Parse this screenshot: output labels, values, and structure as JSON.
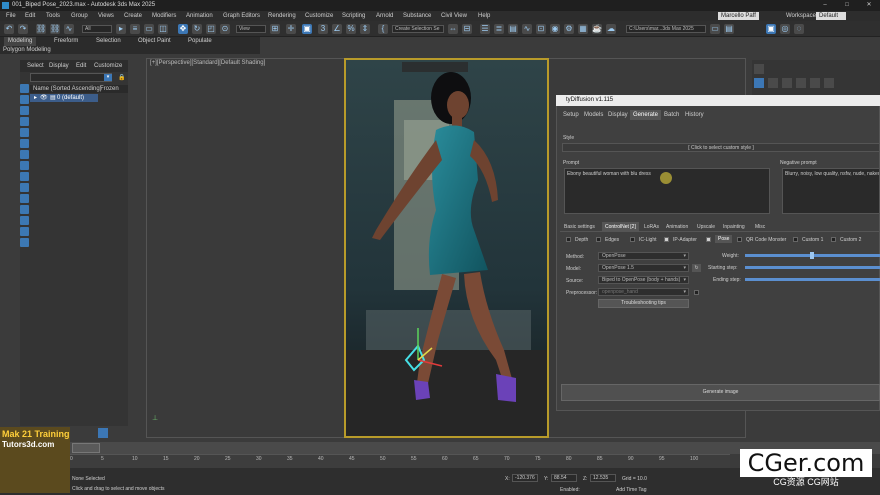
{
  "app": {
    "title": "001_Biped Pose_2023.max - Autodesk 3ds Max 2025"
  },
  "menu": [
    "File",
    "Edit",
    "Tools",
    "Group",
    "Views",
    "Create",
    "Modifiers",
    "Animation",
    "Graph Editors",
    "Rendering",
    "Customize",
    "Scripting",
    "Arnold",
    "Substance",
    "Civil View",
    "Help"
  ],
  "user": {
    "name": "Marcello Paff",
    "workspaces_label": "Workspaces:",
    "workspace": "Default"
  },
  "toolbar": {
    "filter": "All",
    "view": "View",
    "selection_set": "Create Selection Se",
    "path": "C:\\Users\\mar...3ds Max 2025"
  },
  "ribbon": {
    "tabs": [
      "Modeling",
      "Freeform",
      "Selection",
      "Object Paint",
      "Populate"
    ],
    "sub": "Polygon Modeling"
  },
  "scene_explorer": {
    "menu": [
      "Select",
      "Display",
      "Edit",
      "Customize"
    ],
    "col_name": "Name (Sorted Ascending)",
    "col_frozen": "Frozen",
    "row": "0 (default)"
  },
  "viewport": {
    "label": "[+][Perspective][Standard][Default Shading]"
  },
  "sd": {
    "title": "tyDiffusion v1.115",
    "tabs": [
      "Setup",
      "Models",
      "Display",
      "Generate",
      "Batch",
      "History"
    ],
    "style_label": "Style",
    "style_hint": "[ Click to select custom style ]",
    "prompt_label": "Prompt",
    "prompt": "Ebony beautiful woman with blu dress",
    "neg_label": "Negative prompt",
    "neg": "Blurry, noisy, low quality, nsfw, nude, naked",
    "tabs2": [
      "Basic settings",
      "ControlNet [2]",
      "LoRAs",
      "Animation",
      "Upscale",
      "Inpainting",
      "Misc"
    ],
    "cn_items": [
      "Depth",
      "Edges",
      "IC-Light",
      "IP-Adapter",
      "Pose",
      "QR Code Monster",
      "Custom 1",
      "Custom 2"
    ],
    "method_label": "Method:",
    "method": "OpenPose",
    "model_label": "Model:",
    "model": "OpenPose 1.5",
    "source_label": "Source:",
    "source": "Biped to OpenPose (body + hands)",
    "pre_label": "Preprocessor:",
    "pre": "openpose_hand",
    "trouble": "Troubleshooting tips",
    "weight_label": "Weight:",
    "start_label": "Starting step:",
    "end_label": "Ending step:",
    "generate": "Generate image"
  },
  "timeline": {
    "ticks": [
      "0",
      "5",
      "10",
      "15",
      "20",
      "25",
      "30",
      "35",
      "40",
      "45",
      "50",
      "55",
      "60",
      "65",
      "70",
      "75",
      "80",
      "85",
      "90",
      "95",
      "100"
    ]
  },
  "status": {
    "selected": "None Selected",
    "hint": "Click and drag to select and move objects",
    "x_label": "X:",
    "x": "-120.376",
    "y_label": "Y:",
    "y": "88.54",
    "z_label": "Z:",
    "z": "12.535",
    "grid": "Grid = 10.0",
    "enabled": "Enabled:",
    "add_time_tag": "Add Time Tag"
  },
  "watermark": {
    "title": "CGer.com",
    "sub": "CG资源 CG网站",
    "left1": "Mak 21 Training",
    "left2": "Tutors3d.com"
  },
  "colors": {
    "accent": "#3c77b5",
    "render_border": "#b89b2a"
  }
}
